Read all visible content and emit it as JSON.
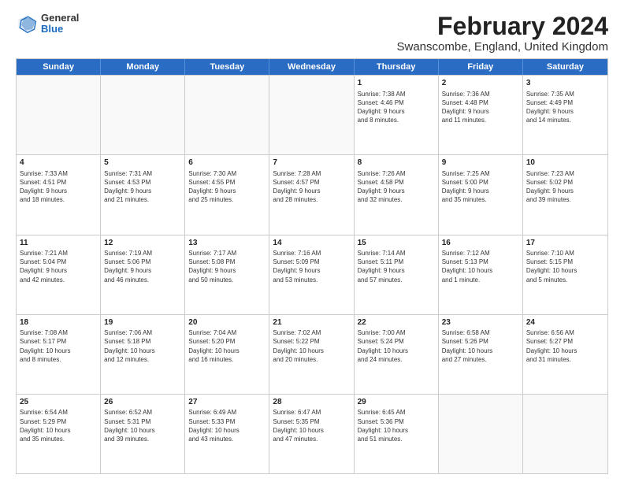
{
  "logo": {
    "general": "General",
    "blue": "Blue"
  },
  "title": {
    "month": "February 2024",
    "location": "Swanscombe, England, United Kingdom"
  },
  "calendar": {
    "headers": [
      "Sunday",
      "Monday",
      "Tuesday",
      "Wednesday",
      "Thursday",
      "Friday",
      "Saturday"
    ],
    "rows": [
      [
        {
          "day": "",
          "info": ""
        },
        {
          "day": "",
          "info": ""
        },
        {
          "day": "",
          "info": ""
        },
        {
          "day": "",
          "info": ""
        },
        {
          "day": "1",
          "info": "Sunrise: 7:38 AM\nSunset: 4:46 PM\nDaylight: 9 hours\nand 8 minutes."
        },
        {
          "day": "2",
          "info": "Sunrise: 7:36 AM\nSunset: 4:48 PM\nDaylight: 9 hours\nand 11 minutes."
        },
        {
          "day": "3",
          "info": "Sunrise: 7:35 AM\nSunset: 4:49 PM\nDaylight: 9 hours\nand 14 minutes."
        }
      ],
      [
        {
          "day": "4",
          "info": "Sunrise: 7:33 AM\nSunset: 4:51 PM\nDaylight: 9 hours\nand 18 minutes."
        },
        {
          "day": "5",
          "info": "Sunrise: 7:31 AM\nSunset: 4:53 PM\nDaylight: 9 hours\nand 21 minutes."
        },
        {
          "day": "6",
          "info": "Sunrise: 7:30 AM\nSunset: 4:55 PM\nDaylight: 9 hours\nand 25 minutes."
        },
        {
          "day": "7",
          "info": "Sunrise: 7:28 AM\nSunset: 4:57 PM\nDaylight: 9 hours\nand 28 minutes."
        },
        {
          "day": "8",
          "info": "Sunrise: 7:26 AM\nSunset: 4:58 PM\nDaylight: 9 hours\nand 32 minutes."
        },
        {
          "day": "9",
          "info": "Sunrise: 7:25 AM\nSunset: 5:00 PM\nDaylight: 9 hours\nand 35 minutes."
        },
        {
          "day": "10",
          "info": "Sunrise: 7:23 AM\nSunset: 5:02 PM\nDaylight: 9 hours\nand 39 minutes."
        }
      ],
      [
        {
          "day": "11",
          "info": "Sunrise: 7:21 AM\nSunset: 5:04 PM\nDaylight: 9 hours\nand 42 minutes."
        },
        {
          "day": "12",
          "info": "Sunrise: 7:19 AM\nSunset: 5:06 PM\nDaylight: 9 hours\nand 46 minutes."
        },
        {
          "day": "13",
          "info": "Sunrise: 7:17 AM\nSunset: 5:08 PM\nDaylight: 9 hours\nand 50 minutes."
        },
        {
          "day": "14",
          "info": "Sunrise: 7:16 AM\nSunset: 5:09 PM\nDaylight: 9 hours\nand 53 minutes."
        },
        {
          "day": "15",
          "info": "Sunrise: 7:14 AM\nSunset: 5:11 PM\nDaylight: 9 hours\nand 57 minutes."
        },
        {
          "day": "16",
          "info": "Sunrise: 7:12 AM\nSunset: 5:13 PM\nDaylight: 10 hours\nand 1 minute."
        },
        {
          "day": "17",
          "info": "Sunrise: 7:10 AM\nSunset: 5:15 PM\nDaylight: 10 hours\nand 5 minutes."
        }
      ],
      [
        {
          "day": "18",
          "info": "Sunrise: 7:08 AM\nSunset: 5:17 PM\nDaylight: 10 hours\nand 8 minutes."
        },
        {
          "day": "19",
          "info": "Sunrise: 7:06 AM\nSunset: 5:18 PM\nDaylight: 10 hours\nand 12 minutes."
        },
        {
          "day": "20",
          "info": "Sunrise: 7:04 AM\nSunset: 5:20 PM\nDaylight: 10 hours\nand 16 minutes."
        },
        {
          "day": "21",
          "info": "Sunrise: 7:02 AM\nSunset: 5:22 PM\nDaylight: 10 hours\nand 20 minutes."
        },
        {
          "day": "22",
          "info": "Sunrise: 7:00 AM\nSunset: 5:24 PM\nDaylight: 10 hours\nand 24 minutes."
        },
        {
          "day": "23",
          "info": "Sunrise: 6:58 AM\nSunset: 5:26 PM\nDaylight: 10 hours\nand 27 minutes."
        },
        {
          "day": "24",
          "info": "Sunrise: 6:56 AM\nSunset: 5:27 PM\nDaylight: 10 hours\nand 31 minutes."
        }
      ],
      [
        {
          "day": "25",
          "info": "Sunrise: 6:54 AM\nSunset: 5:29 PM\nDaylight: 10 hours\nand 35 minutes."
        },
        {
          "day": "26",
          "info": "Sunrise: 6:52 AM\nSunset: 5:31 PM\nDaylight: 10 hours\nand 39 minutes."
        },
        {
          "day": "27",
          "info": "Sunrise: 6:49 AM\nSunset: 5:33 PM\nDaylight: 10 hours\nand 43 minutes."
        },
        {
          "day": "28",
          "info": "Sunrise: 6:47 AM\nSunset: 5:35 PM\nDaylight: 10 hours\nand 47 minutes."
        },
        {
          "day": "29",
          "info": "Sunrise: 6:45 AM\nSunset: 5:36 PM\nDaylight: 10 hours\nand 51 minutes."
        },
        {
          "day": "",
          "info": ""
        },
        {
          "day": "",
          "info": ""
        }
      ]
    ]
  }
}
